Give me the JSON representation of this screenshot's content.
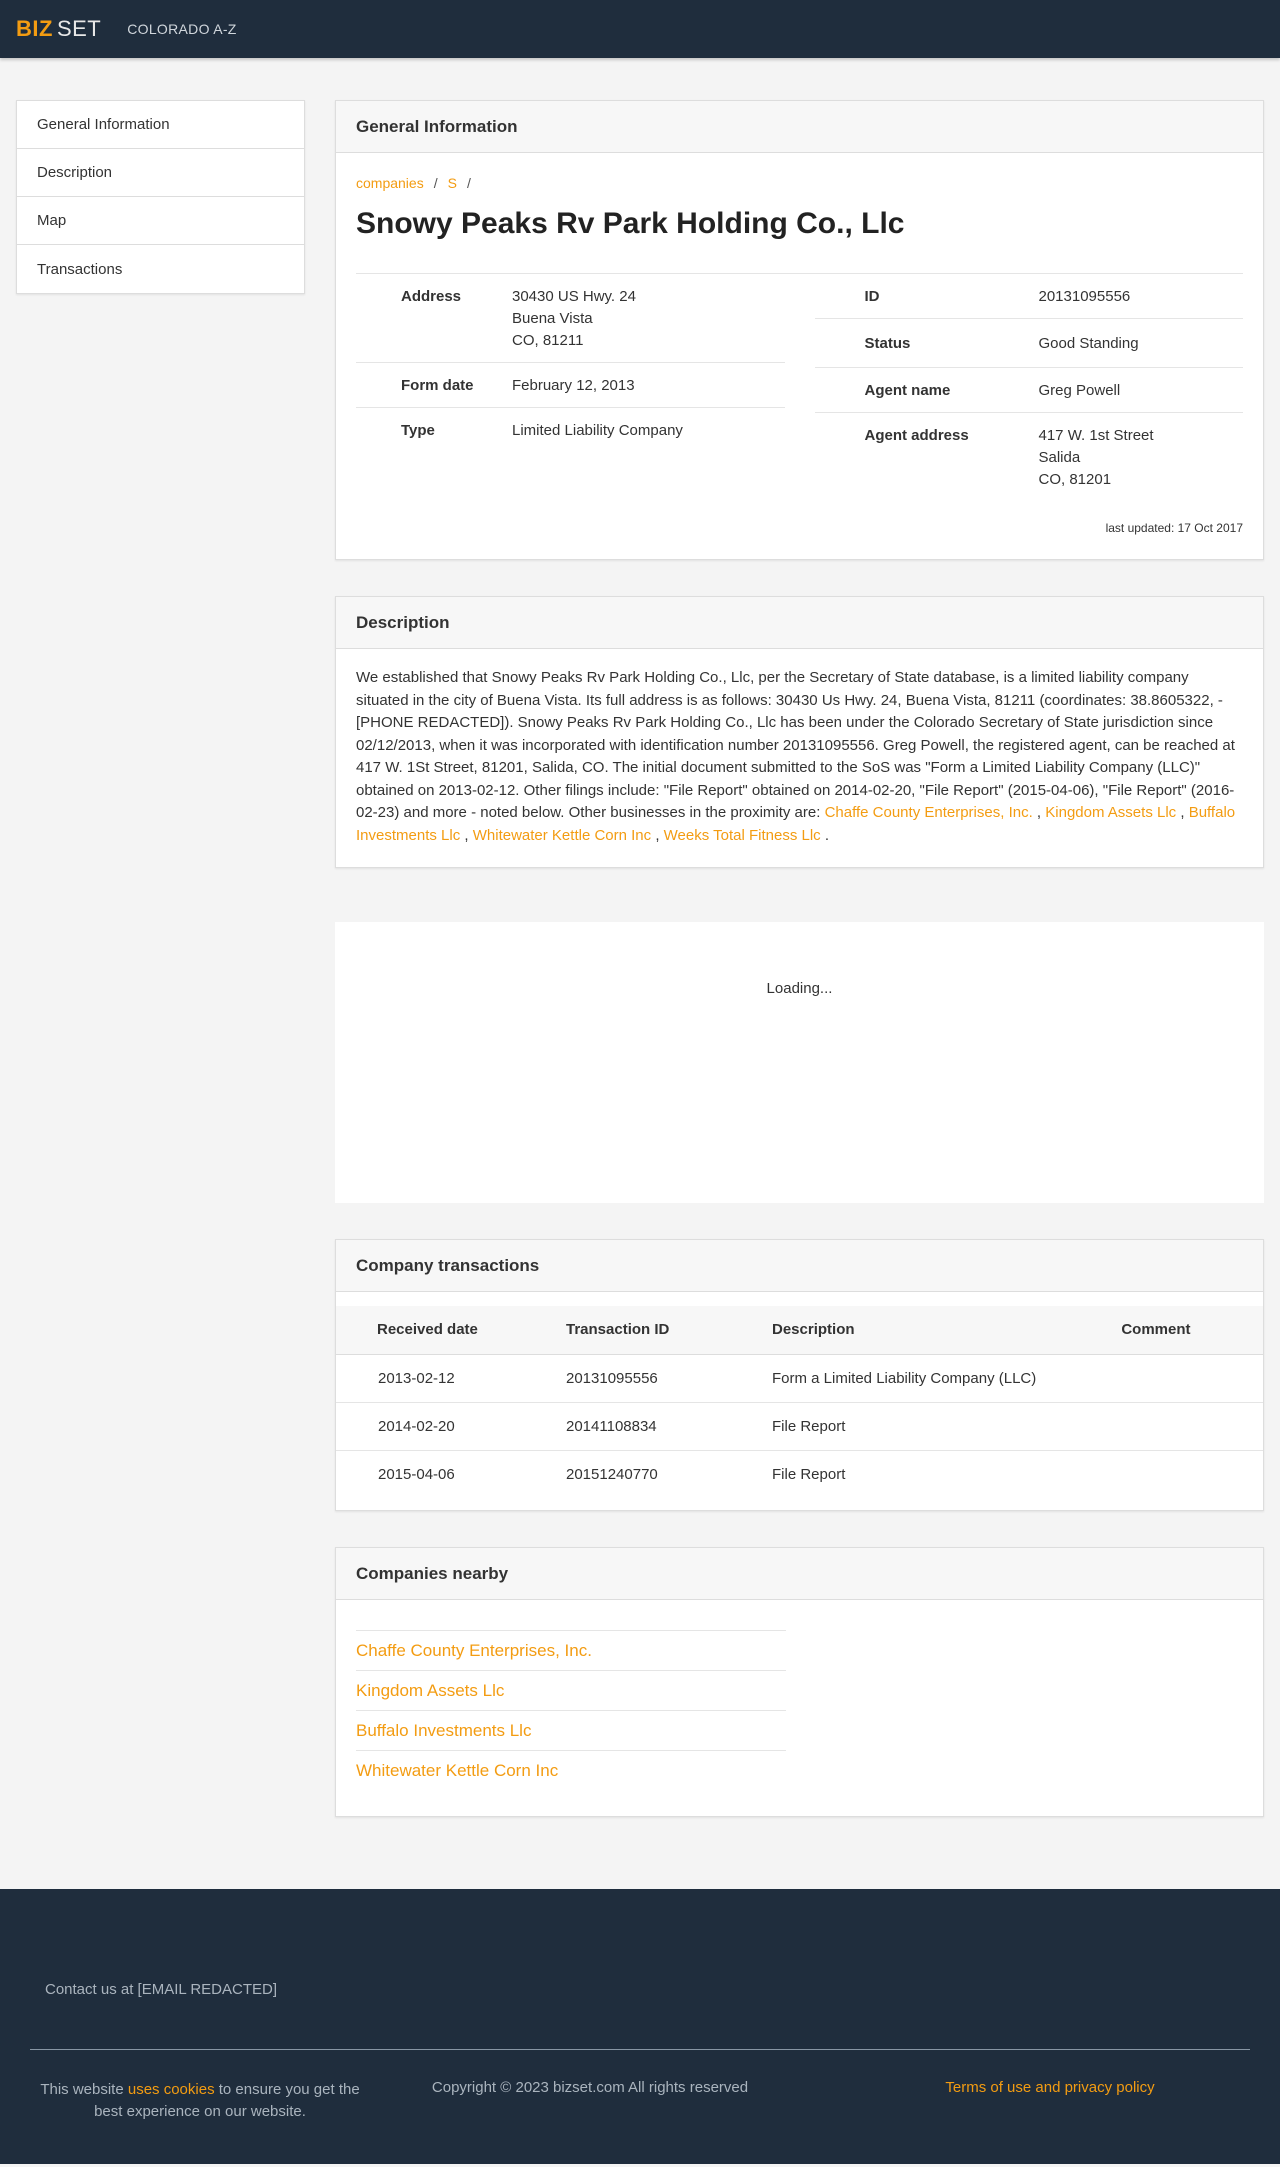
{
  "nav": {
    "brand_bold": "BIZ",
    "brand_light": "SET",
    "link": "COLORADO A-Z"
  },
  "sidebar": {
    "items": [
      {
        "label": "General Information"
      },
      {
        "label": "Description"
      },
      {
        "label": "Map"
      },
      {
        "label": "Transactions"
      }
    ]
  },
  "general": {
    "heading": "General Information",
    "breadcrumb": [
      "companies",
      "S"
    ],
    "title": "Snowy Peaks Rv Park Holding Co., Llc",
    "address_label": "Address",
    "address_lines": [
      "30430 US Hwy. 24",
      "Buena Vista",
      "CO, 81211"
    ],
    "form_date_label": "Form date",
    "form_date": "February 12, 2013",
    "type_label": "Type",
    "type": "Limited Liability Company",
    "id_label": "ID",
    "id": "20131095556",
    "status_label": "Status",
    "status": "Good Standing",
    "agent_name_label": "Agent name",
    "agent_name": "Greg Powell",
    "agent_address_label": "Agent address",
    "agent_address_lines": [
      "417 W. 1st Street",
      "Salida",
      "CO, 81201"
    ],
    "last_updated": "last updated: 17 Oct 2017"
  },
  "description": {
    "heading": "Description",
    "text": "We established that Snowy Peaks Rv Park Holding Co., Llc, per the Secretary of State database, is a limited liability company situated in the city of Buena Vista. Its full address is as follows: 30430 Us Hwy. 24, Buena Vista, 81211 (coordinates: 38.8605322, -[PHONE REDACTED]). Snowy Peaks Rv Park Holding Co., Llc has been under the Colorado Secretary of State jurisdiction since 02/12/2013, when it was incorporated with identification number 20131095556. Greg Powell, the registered agent, can be reached at 417 W. 1St Street, 81201, Salida, CO. The initial document submitted to the SoS was \"Form a Limited Liability Company (LLC)\" obtained on 2013-02-12. Other filings include: \"File Report\" obtained on 2014-02-20, \"File Report\" (2015-04-06), \"File Report\" (2016-02-23) and more - noted below. Other businesses in the proximity are: ",
    "links": [
      "Chaffe County Enterprises, Inc.",
      "Kingdom Assets Llc",
      "Buffalo Investments Llc",
      "Whitewater Kettle Corn Inc",
      "Weeks Total Fitness Llc"
    ],
    "separator": ",",
    "end": "."
  },
  "map": {
    "loading": "Loading..."
  },
  "transactions": {
    "heading": "Company transactions",
    "columns": [
      "Received date",
      "Transaction ID",
      "Description",
      "Comment"
    ],
    "rows": [
      [
        "2013-02-12",
        "20131095556",
        "Form a Limited Liability Company (LLC)",
        ""
      ],
      [
        "2014-02-20",
        "20141108834",
        "File Report",
        ""
      ],
      [
        "2015-04-06",
        "20151240770",
        "File Report",
        ""
      ]
    ]
  },
  "nearby": {
    "heading": "Companies nearby",
    "items": [
      "Chaffe County Enterprises, Inc.",
      "Kingdom Assets Llc",
      "Buffalo Investments Llc",
      "Whitewater Kettle Corn Inc"
    ]
  },
  "footer": {
    "contact": "Contact us at [EMAIL REDACTED]",
    "cookie_pre": "This website",
    "cookie_link": "uses cookies",
    "cookie_post": "to ensure you get the best experience on our website.",
    "copyright": "Copyright © 2023 bizset.com All rights reserved",
    "terms": "Terms of use and privacy policy"
  },
  "colors": {
    "navbar": "#1f2d3d",
    "accent": "#f39c12",
    "background": "#f4f4f4"
  }
}
